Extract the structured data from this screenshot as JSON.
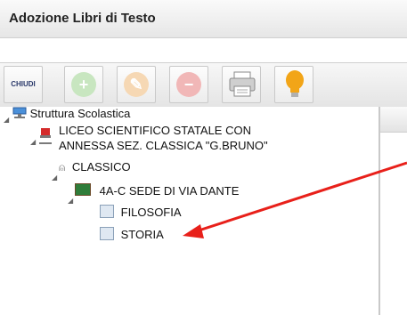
{
  "window": {
    "title": "Adozione Libri di Testo"
  },
  "toolbar": {
    "chiudi_label": "CHIUDI",
    "buttons": [
      {
        "name": "add",
        "icon": "plus-circle-icon",
        "color": "#c8e6c0"
      },
      {
        "name": "edit",
        "icon": "pencil-circle-icon",
        "color": "#f6d8b4"
      },
      {
        "name": "delete",
        "icon": "minus-circle-icon",
        "color": "#f1b7b7"
      },
      {
        "name": "print",
        "icon": "printer-icon"
      },
      {
        "name": "hint",
        "icon": "lightbulb-icon",
        "color": "#f2a518"
      }
    ]
  },
  "tree": {
    "root": "Struttura Scolastica",
    "school_line1": "LICEO SCIENTIFICO STATALE CON",
    "school_line2": "ANNESSA SEZ. CLASSICA \"G.BRUNO\"",
    "course": "CLASSICO",
    "class": "4A-C SEDE DI VIA DANTE",
    "subjects": [
      "FILOSOFIA",
      "STORIA"
    ]
  },
  "annotation": {
    "arrow_color": "#e8201a"
  }
}
